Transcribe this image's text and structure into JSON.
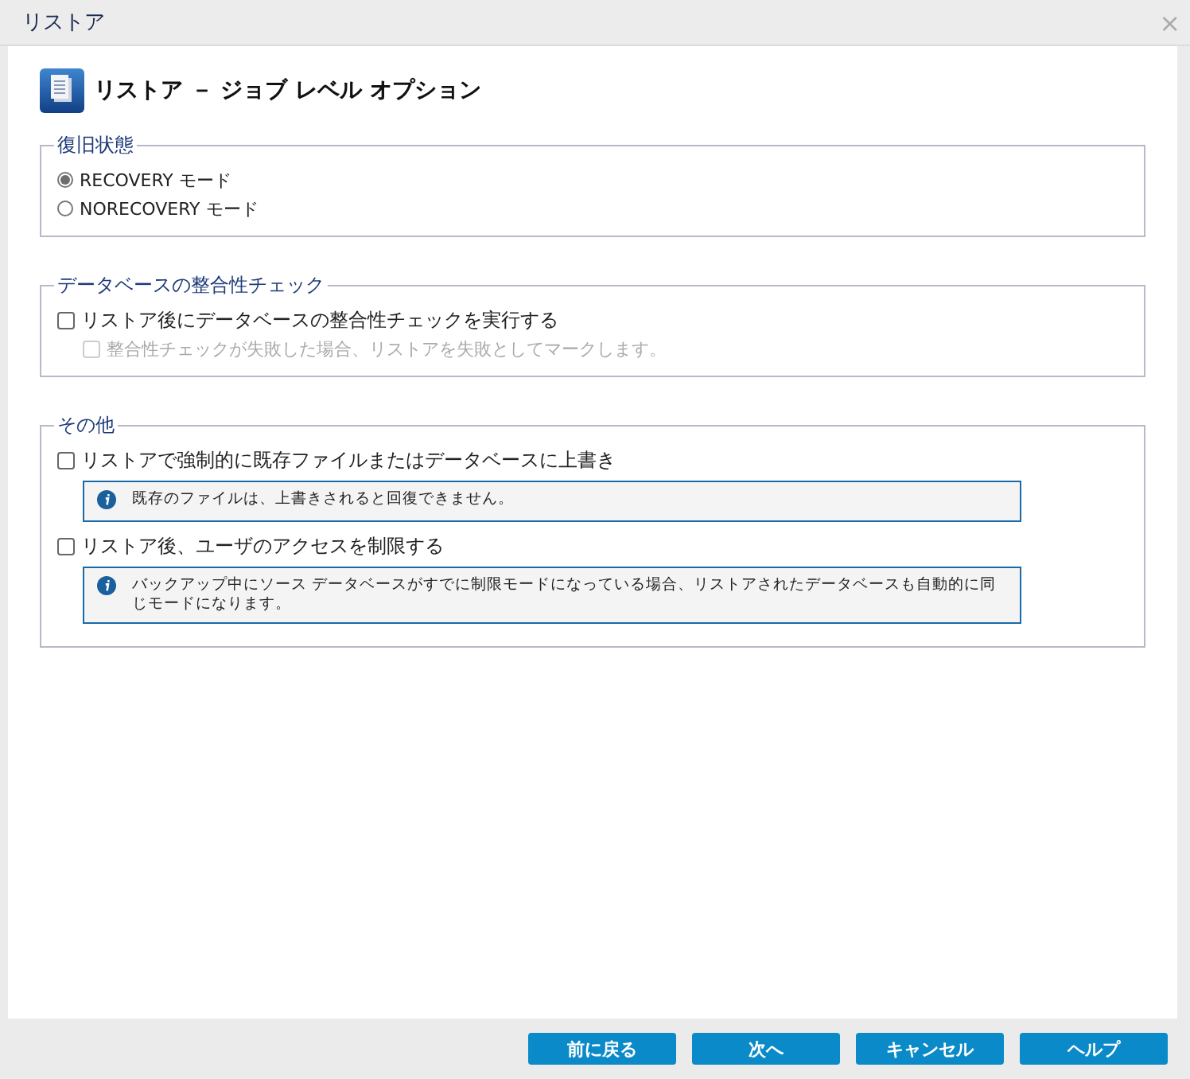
{
  "window": {
    "title": "リストア",
    "close": "×"
  },
  "heading": "リストア － ジョブ レベル オプション",
  "sections": [
    {
      "title": "復旧状態",
      "items": [
        {
          "kind": "radio",
          "label": "RECOVERY モード",
          "selected": true,
          "disabled": false
        },
        {
          "kind": "radio",
          "label": "NORECOVERY モード",
          "selected": false,
          "disabled": false
        }
      ]
    },
    {
      "title": "データベースの整合性チェック",
      "items": [
        {
          "kind": "checkbox",
          "label": "リストア後にデータベースの整合性チェックを実行する",
          "checked": false,
          "disabled": false,
          "children": [
            {
              "kind": "checkbox",
              "label": "整合性チェックが失敗した場合、リストアを失敗としてマークします。",
              "checked": false,
              "disabled": true
            }
          ]
        }
      ]
    },
    {
      "title": "その他",
      "items": [
        {
          "kind": "checkbox",
          "label": "リストアで強制的に既存ファイルまたはデータベースに上書き",
          "checked": false,
          "disabled": false
        },
        {
          "kind": "info",
          "text": "既存のファイルは、上書きされると回復できません。"
        },
        {
          "kind": "checkbox",
          "label": "リストア後、ユーザのアクセスを制限する",
          "checked": false,
          "disabled": false
        },
        {
          "kind": "info",
          "text": "バックアップ中にソース データベースがすでに制限モードになっている場合、リストアされたデータベースも自動的に同じモードになります。"
        }
      ]
    }
  ],
  "buttons": [
    "前に戻る",
    "次へ",
    "キャンセル",
    "ヘルプ"
  ]
}
